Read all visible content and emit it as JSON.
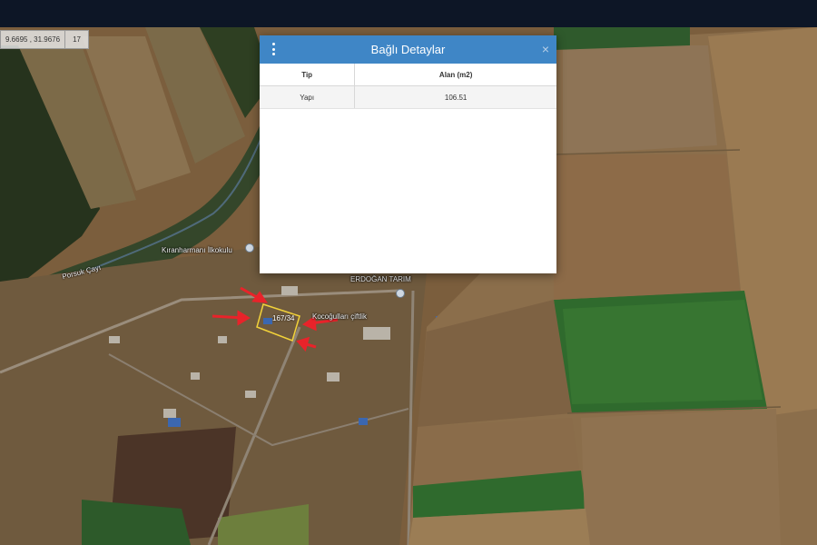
{
  "map": {
    "coordinates": "9.6695 , 31.9676",
    "zoom": "17",
    "labels": {
      "school": "Kıranharmanı İlkokulu",
      "river": "Porsuk Çayı",
      "farm": "ERDOĞAN TARIM",
      "chiftlik": "Kocoğulları çiftlik",
      "parcel": "167/34"
    }
  },
  "modal": {
    "title": "Bağlı Detaylar",
    "close": "×",
    "table": {
      "headers": [
        "Tip",
        "Alan (m2)"
      ],
      "rows": [
        [
          "Yapı",
          "106.51"
        ]
      ]
    }
  },
  "colors": {
    "header_blue": "#3f86c6",
    "annotation_arrow": "#e8232a",
    "parcel_outline": "#f2d23a"
  },
  "icons": [
    "more-vert-icon",
    "close-icon",
    "location-pin-icon",
    "arrow-icon"
  ]
}
